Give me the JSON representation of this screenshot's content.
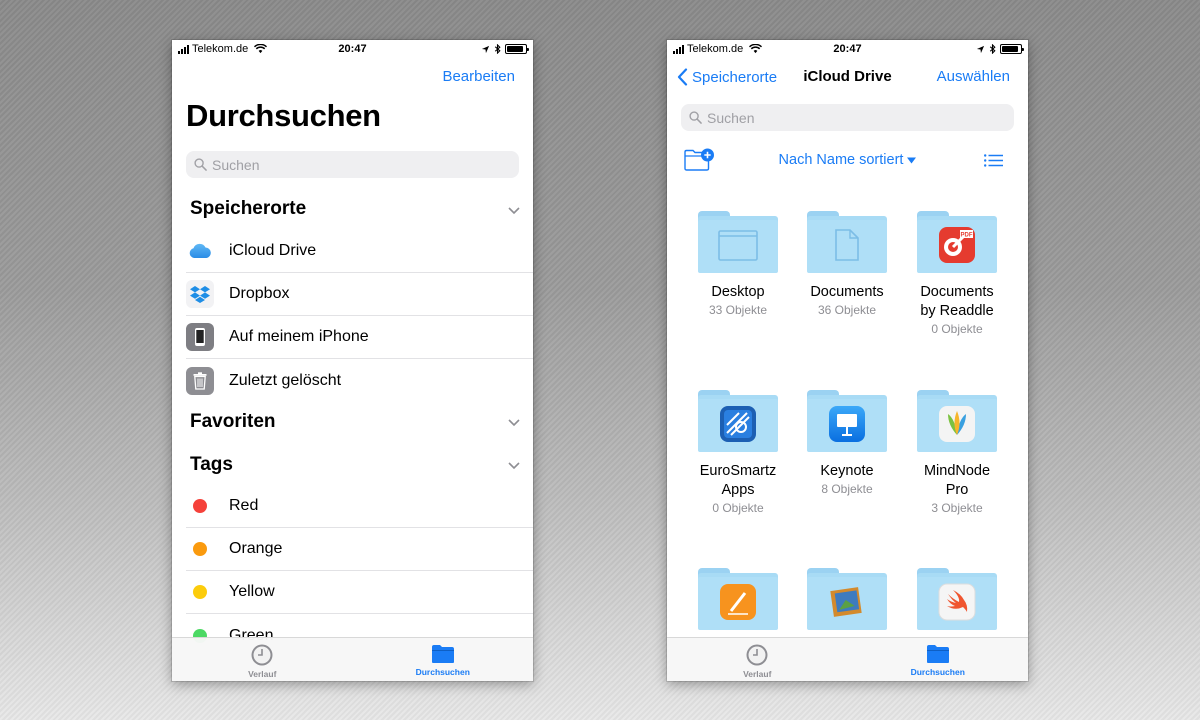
{
  "colors": {
    "accent": "#1a7cf5",
    "tag_red": "#f5413a",
    "tag_orange": "#fa9a0e",
    "tag_yellow": "#fccc0c",
    "tag_green": "#4cd964",
    "folder": "#a8dbf5"
  },
  "status_bar": {
    "carrier": "Telekom.de",
    "time": "20:47",
    "battery_level": 0.9
  },
  "browse_screen": {
    "edit_label": "Bearbeiten",
    "title": "Durchsuchen",
    "search_placeholder": "Suchen",
    "locations_header": "Speicherorte",
    "locations": [
      {
        "label": "iCloud Drive",
        "icon": "icloud-icon"
      },
      {
        "label": "Dropbox",
        "icon": "dropbox-icon"
      },
      {
        "label": "Auf meinem iPhone",
        "icon": "iphone-icon"
      },
      {
        "label": "Zuletzt gelöscht",
        "icon": "trash-icon"
      }
    ],
    "favorites_header": "Favoriten",
    "tags_header": "Tags",
    "tags": [
      {
        "label": "Red",
        "color": "#f5413a"
      },
      {
        "label": "Orange",
        "color": "#fa9a0e"
      },
      {
        "label": "Yellow",
        "color": "#fccc0c"
      },
      {
        "label": "Green",
        "color": "#4cd964"
      }
    ]
  },
  "icloud_screen": {
    "back_label": "Speicherorte",
    "title": "iCloud Drive",
    "select_label": "Auswählen",
    "search_placeholder": "Suchen",
    "sort_label": "Nach Name sortiert",
    "folders": [
      {
        "name": "Desktop",
        "name2": "",
        "count": "33 Objekte",
        "emblem": "desktop-emblem-icon"
      },
      {
        "name": "Documents",
        "name2": "",
        "count": "36 Objekte",
        "emblem": "document-emblem-icon"
      },
      {
        "name": "Documents",
        "name2": "by Readdle",
        "count": "0 Objekte",
        "emblem": "pdf-expert-app-icon"
      },
      {
        "name": "EuroSmartz",
        "name2": "Apps",
        "count": "0 Objekte",
        "emblem": "eurosmartz-app-icon"
      },
      {
        "name": "Keynote",
        "name2": "",
        "count": "8 Objekte",
        "emblem": "keynote-app-icon"
      },
      {
        "name": "MindNode",
        "name2": "Pro",
        "count": "3 Objekte",
        "emblem": "mindnode-app-icon"
      },
      {
        "name": "",
        "name2": "",
        "count": "",
        "emblem": "pages-app-icon"
      },
      {
        "name": "",
        "name2": "",
        "count": "",
        "emblem": "preview-app-icon"
      },
      {
        "name": "",
        "name2": "",
        "count": "",
        "emblem": "swift-playgrounds-app-icon"
      }
    ]
  },
  "tab_bar": {
    "tabs": [
      {
        "label": "Verlauf",
        "icon": "clock-icon",
        "active": false
      },
      {
        "label": "Durchsuchen",
        "icon": "folder-icon",
        "active": true
      }
    ]
  }
}
